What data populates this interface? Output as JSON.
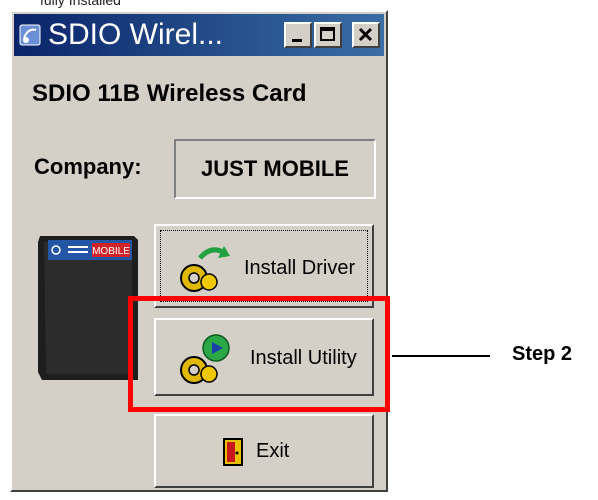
{
  "page_top_text": "fully Installed",
  "window": {
    "title": "SDIO Wirel...",
    "controls": {
      "minimize": "_",
      "maximize": "□",
      "close": "×"
    }
  },
  "heading": "SDIO 11B Wireless Card",
  "company": {
    "label": "Company:",
    "value": "JUST MOBILE"
  },
  "card_image": {
    "brand": "MOBILE"
  },
  "buttons": {
    "install_driver": "Install Driver",
    "install_utility": "Install Utility",
    "exit": "Exit"
  },
  "annotation": {
    "step_label": "Step 2",
    "highlight_color": "#ff0000"
  },
  "colors": {
    "titlebar_start": "#0a246a",
    "titlebar_end": "#3a6ea5",
    "window_bg": "#d4d0c8"
  },
  "icons": [
    "app-icon",
    "minimize-icon",
    "maximize-icon",
    "close-icon",
    "gear-refresh-icon",
    "gear-play-icon",
    "exit-door-icon"
  ]
}
